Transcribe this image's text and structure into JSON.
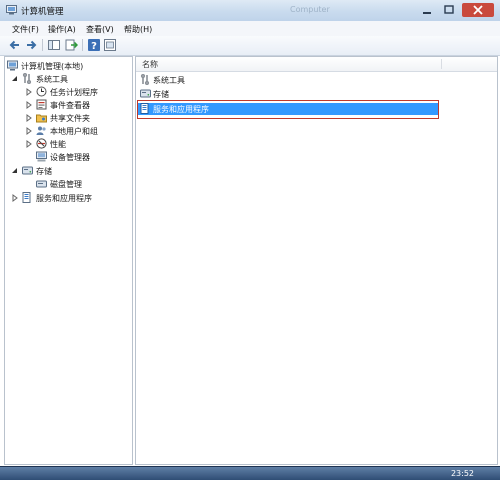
{
  "window": {
    "title": "计算机管理",
    "title_extra": "Computer"
  },
  "menu": [
    "文件(F)",
    "操作(A)",
    "查看(V)",
    "帮助(H)"
  ],
  "toolbar_icons": [
    "back-icon",
    "forward-icon",
    "console-tree-icon",
    "export-icon",
    "help-icon",
    "properties-icon"
  ],
  "tree": [
    {
      "label": "计算机管理(本地)",
      "icon": "computer-management-icon"
    },
    {
      "label": "系统工具",
      "icon": "system-tools-icon"
    },
    {
      "label": "任务计划程序",
      "icon": "task-scheduler-icon"
    },
    {
      "label": "事件查看器",
      "icon": "event-viewer-icon"
    },
    {
      "label": "共享文件夹",
      "icon": "shared-folders-icon"
    },
    {
      "label": "本地用户和组",
      "icon": "local-users-icon"
    },
    {
      "label": "性能",
      "icon": "performance-icon"
    },
    {
      "label": "设备管理器",
      "icon": "device-manager-icon"
    },
    {
      "label": "存储",
      "icon": "storage-icon"
    },
    {
      "label": "磁盘管理",
      "icon": "disk-management-icon"
    },
    {
      "label": "服务和应用程序",
      "icon": "services-apps-icon"
    }
  ],
  "list": {
    "header": "名称",
    "items": [
      {
        "label": "系统工具",
        "icon": "system-tools-icon"
      },
      {
        "label": "存储",
        "icon": "storage-icon"
      },
      {
        "label": "服务和应用程序",
        "icon": "services-apps-icon",
        "selected": true
      }
    ]
  },
  "taskbar": {
    "clock": "23:52"
  },
  "colors": {
    "selection": "#3399ff",
    "highlight_box": "#c0392b"
  }
}
